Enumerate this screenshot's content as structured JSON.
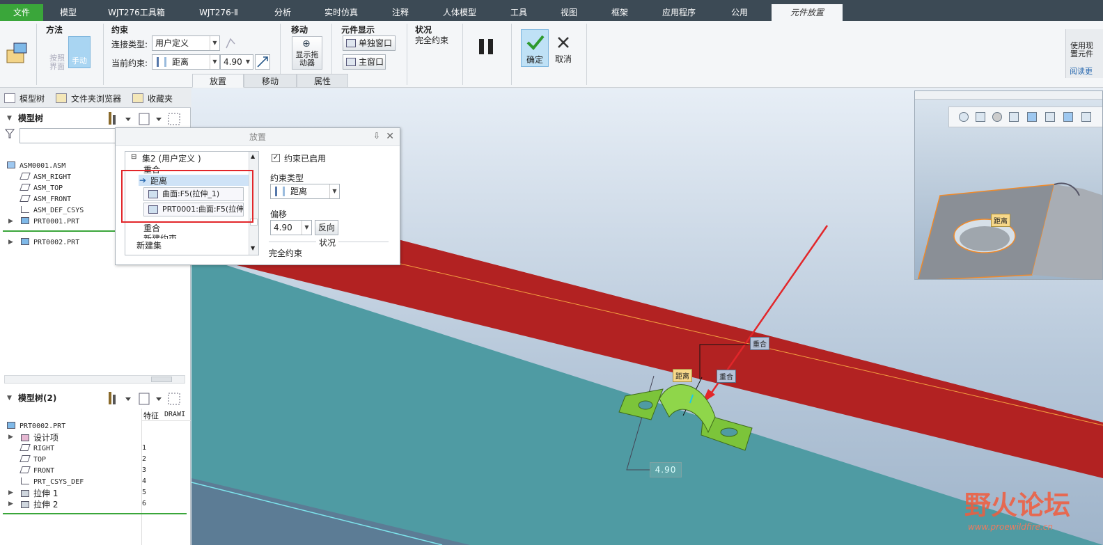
{
  "menu": {
    "file": "文件",
    "tabs": [
      "模型",
      "WJT276工具箱",
      "WJT276-Ⅱ",
      "分析",
      "实时仿真",
      "注释",
      "人体模型",
      "工具",
      "视图",
      "框架",
      "应用程序",
      "公用"
    ],
    "active_tab": "元件放置"
  },
  "ribbon": {
    "method": {
      "title": "方法",
      "by_ui": "按照\n界面",
      "manual": "手动"
    },
    "constraint": {
      "title": "约束",
      "connection_type_label": "连接类型:",
      "connection_type_value": "用户定义",
      "current_constraint_label": "当前约束:",
      "current_constraint_value": "距离",
      "offset_value": "4.90"
    },
    "move": {
      "title": "移动",
      "show_dragger": "显示拖\n动器"
    },
    "component_display": {
      "title": "元件显示",
      "separate_window": "单独窗口",
      "main_window": "主窗口"
    },
    "status": {
      "title": "状况",
      "value": "完全约束"
    },
    "confirm": "确定",
    "cancel": "取消",
    "right_hint": "使用现\n置元件",
    "right_link": "阅读更"
  },
  "subtabs": [
    "放置",
    "移动",
    "属性"
  ],
  "left_panel": {
    "tabs": [
      "模型树",
      "文件夹浏览器",
      "收藏夹"
    ],
    "tree1_title": "模型树",
    "tree1_items": [
      "ASM0001.ASM",
      "ASM_RIGHT",
      "ASM_TOP",
      "ASM_FRONT",
      "ASM_DEF_CSYS",
      "PRT0001.PRT",
      "PRT0002.PRT"
    ],
    "tree2_title": "模型树(2)",
    "tree2_columns": [
      "特征",
      "DRAWI"
    ],
    "tree2_items": [
      {
        "name": "PRT0002.PRT",
        "num": ""
      },
      {
        "name": "设计项",
        "num": ""
      },
      {
        "name": "RIGHT",
        "num": "1"
      },
      {
        "name": "TOP",
        "num": "2"
      },
      {
        "name": "FRONT",
        "num": "3"
      },
      {
        "name": "PRT_CSYS_DEF",
        "num": "4"
      },
      {
        "name": "拉伸 1",
        "num": "5"
      },
      {
        "name": "拉伸 2",
        "num": "6"
      }
    ]
  },
  "dialog": {
    "title": "放置",
    "set_label": "集2 (用户定义 )",
    "items": [
      "重合",
      "距离",
      "重合",
      "新建约束",
      "新建集"
    ],
    "ref1": "曲面:F5(拉伸_1)",
    "ref2": "PRT0001:曲面:F5(拉伸",
    "enabled_label": "约束已启用",
    "constraint_type_label": "约束类型",
    "constraint_type_value": "距离",
    "offset_label": "偏移",
    "offset_value": "4.90",
    "flip_button": "反向",
    "status_label": "状况",
    "status_value": "完全约束"
  },
  "viewport": {
    "tags": {
      "distance": "距离",
      "coincident": "重合"
    },
    "dimension": "4.90"
  },
  "watermark": {
    "main": "野火论坛",
    "sub": "www.proewildfire.cn"
  },
  "colors": {
    "menubar": "#3c4a55",
    "file_tab": "#3aa63a",
    "red_plane": "#b22222",
    "teal_plane": "#4f9ba3",
    "part_green": "#7cc43a",
    "highlight_box": "#e2262a"
  }
}
